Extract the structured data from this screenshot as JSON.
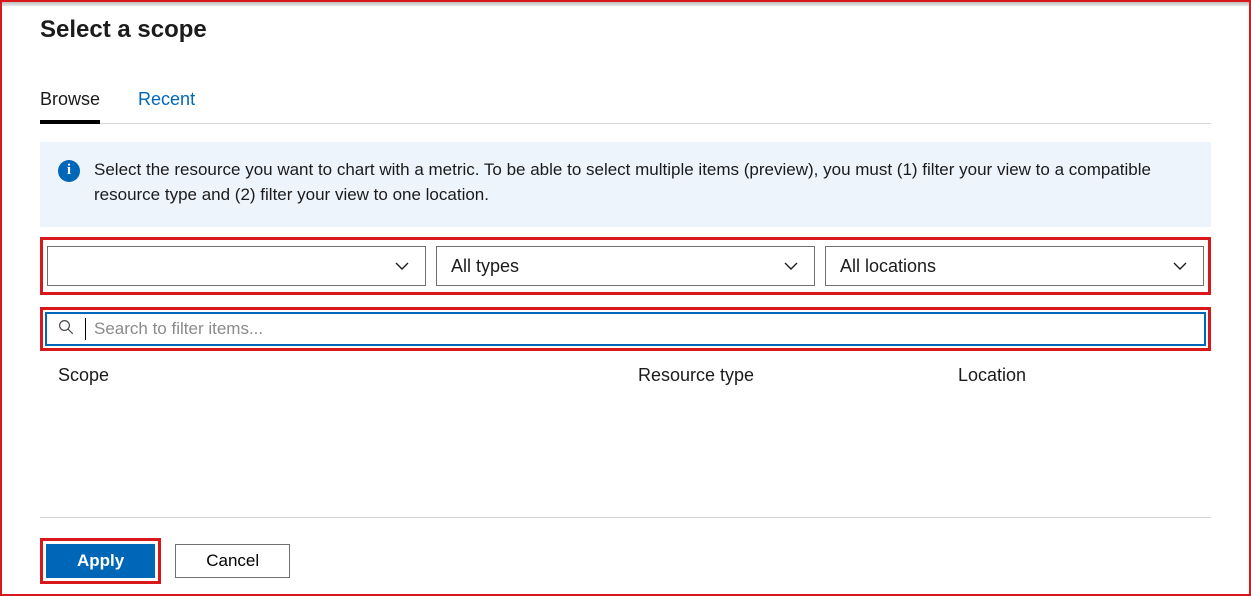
{
  "title": "Select a scope",
  "tabs": {
    "browse": "Browse",
    "recent": "Recent"
  },
  "info": {
    "text": "Select the resource you want to chart with a metric. To be able to select multiple items (preview), you must (1) filter your view to a compatible resource type and (2) filter your view to one location."
  },
  "filters": {
    "subscription": {
      "value": ""
    },
    "type": {
      "value": "All types"
    },
    "location": {
      "value": "All locations"
    }
  },
  "search": {
    "placeholder": "Search to filter items..."
  },
  "columns": {
    "scope": "Scope",
    "resource_type": "Resource type",
    "location": "Location"
  },
  "buttons": {
    "apply": "Apply",
    "cancel": "Cancel"
  },
  "colors": {
    "accent": "#0067b8",
    "callout": "#d8181a"
  }
}
